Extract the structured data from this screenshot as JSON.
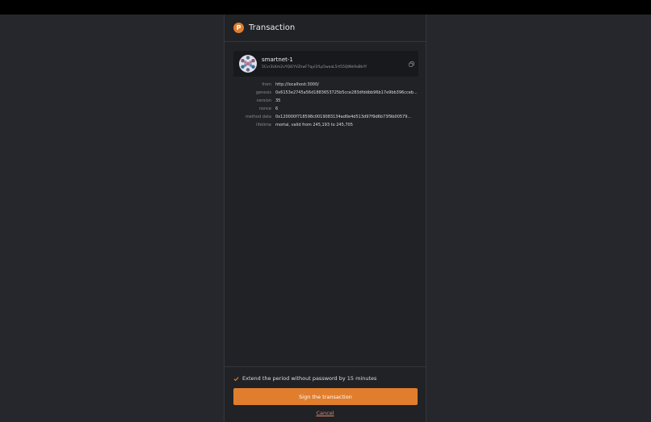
{
  "header": {
    "title": "Transaction",
    "logo_glyph": "P"
  },
  "account": {
    "name": "smartnet-1",
    "address": "5Cvr3LKm2vYQiEYVZswF7qyi1fLp5woaL5rt55QtNk9aBkYf"
  },
  "details": [
    {
      "label": "from",
      "value": "http://localhost:3000/"
    },
    {
      "label": "genesis",
      "value": "0x6153e2745a56d1883653725b5cce283dfddbb96b17e9bb396cceb..."
    },
    {
      "label": "version",
      "value": "35"
    },
    {
      "label": "nonce",
      "value": "6"
    },
    {
      "label": "method data",
      "value": "0x120000f718598c0019083134ad0e4d513d97f9d6b73f9b00579..."
    },
    {
      "label": "lifetime",
      "value": "mortal, valid from 245,193 to 245,705"
    }
  ],
  "footer": {
    "checkbox_checked": true,
    "checkbox_label": "Extend the period without password by 15 minutes",
    "sign_label": "Sign the transaction",
    "cancel_label": "Cancel"
  },
  "colors": {
    "accent": "#e07e2d",
    "background": "#26272c",
    "panel": "#212226"
  }
}
